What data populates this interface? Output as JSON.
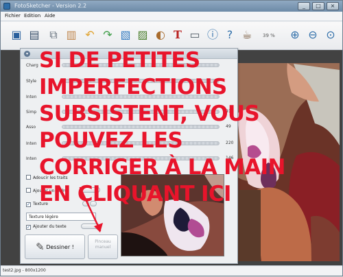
{
  "window": {
    "title": "FotoSketcher - Version 2.2"
  },
  "menu": [
    "Fichier",
    "Edition",
    "Aide"
  ],
  "toolbar": {
    "icons": [
      "new-project-icon",
      "save-icon",
      "copy-icon",
      "paste-icon",
      "undo-icon",
      "redo-icon",
      "picture-icon",
      "landscape-icon",
      "palette-icon",
      "text-icon",
      "print-icon",
      "info-icon",
      "help-icon",
      "coffee-icon",
      "zoom-in-icon",
      "zoom-out-icon",
      "zoom-fit-icon"
    ],
    "zoom_label": "39 %"
  },
  "panel": {
    "header": "",
    "settings": [
      {
        "label": "Charg",
        "value": ""
      },
      {
        "label": "Style",
        "value": ""
      },
      {
        "label": "Inten",
        "value": ""
      },
      {
        "label": "Simp",
        "value": "91"
      },
      {
        "label": "Asso",
        "value": "49"
      },
      {
        "label": "Inten",
        "value": "220"
      },
      {
        "label": "Inten",
        "value": "146"
      }
    ],
    "checkbox_adoucir": "Adoucir les traits",
    "checkbox_cadre": "Ajouter un cadre",
    "checkbox_texture": "Texture",
    "texture_value": "Texture légère",
    "checkbox_texte": "Ajouter du texte",
    "draw_button": "Dessiner !",
    "manual_brush_button": "Pinceau manuel"
  },
  "caption": {
    "text": "Si de petites imperfections\nsubsistent, vous pouvez les\ncorriger à la main\nen cliquant ici"
  },
  "status": {
    "file": "test2.jpg - 800x1200"
  },
  "colors": {
    "annotation": "#e8142b",
    "toolbar_blue": "#2f6ea9"
  }
}
